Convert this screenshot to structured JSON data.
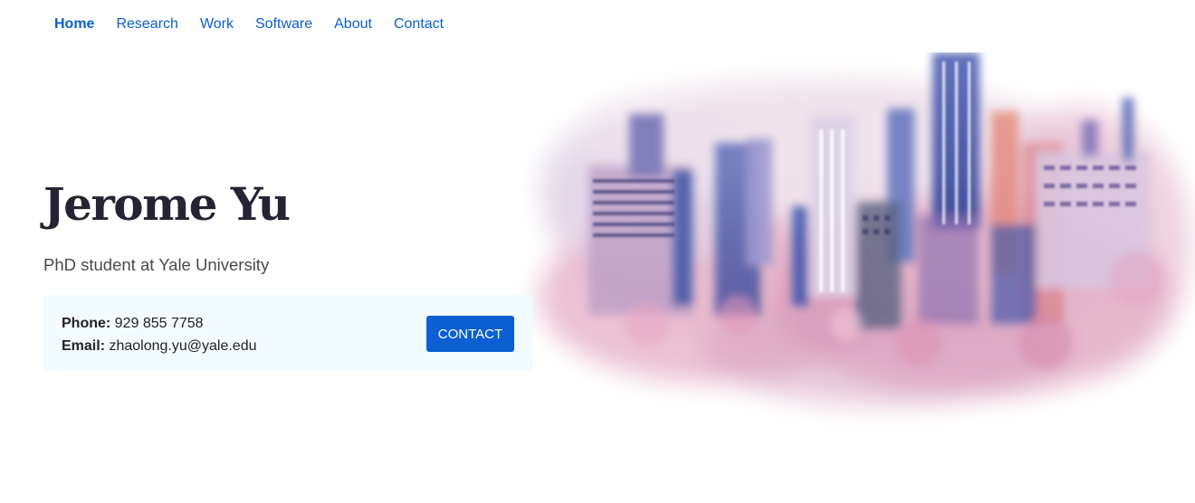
{
  "nav": {
    "items": [
      {
        "label": "Home",
        "active": true
      },
      {
        "label": "Research",
        "active": false
      },
      {
        "label": "Work",
        "active": false
      },
      {
        "label": "Software",
        "active": false
      },
      {
        "label": "About",
        "active": false
      },
      {
        "label": "Contact",
        "active": false
      }
    ]
  },
  "hero": {
    "name": "Jerome Yu",
    "subtitle": "PhD student at Yale University",
    "phone_label": "Phone:",
    "phone": "929 855 7758",
    "email_label": "Email:",
    "email": "zhaolong.yu@yale.edu",
    "contact_button": "CONTACT",
    "image_subject": "watercolor-city-skyline"
  },
  "colors": {
    "link": "#0b5fd0",
    "button": "#0b5fd0",
    "heading": "#262335",
    "contact_bg": "#f2fbfd"
  }
}
